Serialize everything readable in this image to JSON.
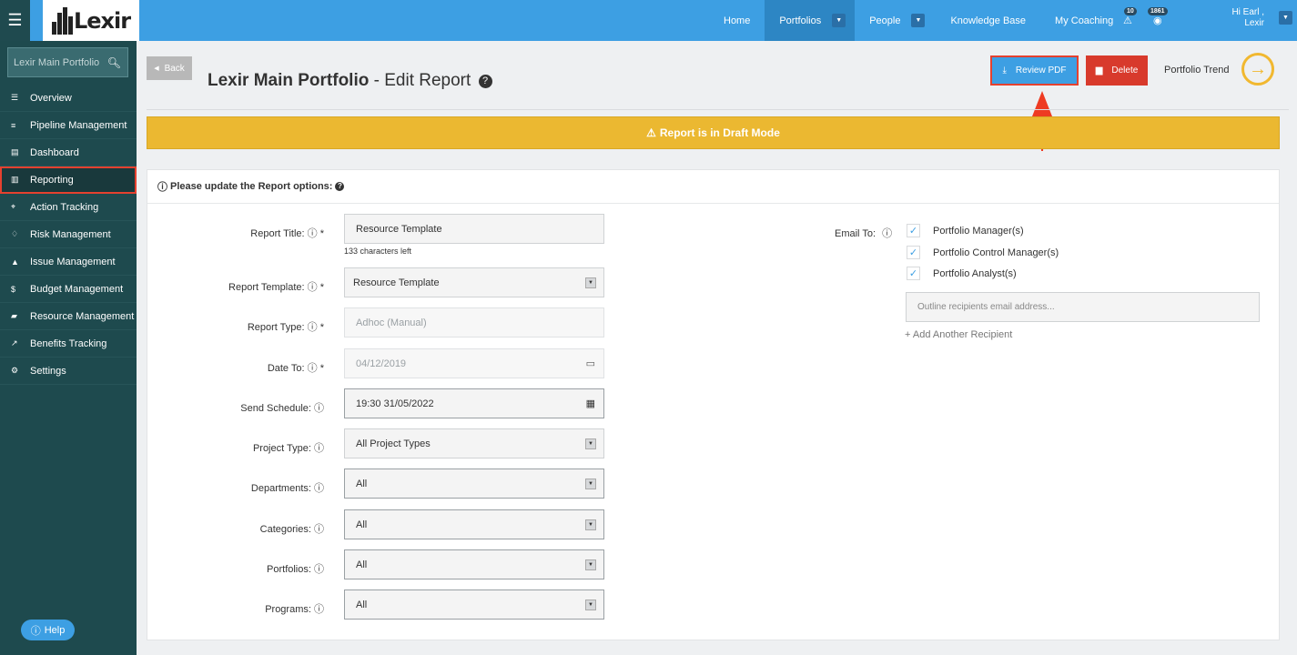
{
  "topbar": {
    "menu_icon": "hamburger-icon",
    "logo_text": "Lexir",
    "nav": [
      {
        "label": "Home"
      },
      {
        "label": "Portfolios"
      },
      {
        "label": "People"
      },
      {
        "label": "Knowledge Base"
      },
      {
        "label": "My Coaching"
      }
    ],
    "alerts_count": "10",
    "notifications_count": "1861",
    "greeting": "Hi Earl ,",
    "user_name": "Lexir"
  },
  "sidebar": {
    "search_placeholder": "Lexir Main Portfolio",
    "items": [
      {
        "label": "Overview",
        "icon": "list-icon"
      },
      {
        "label": "Pipeline Management",
        "icon": "lines-icon"
      },
      {
        "label": "Dashboard",
        "icon": "dashboard-icon"
      },
      {
        "label": "Reporting",
        "icon": "bar-chart-icon"
      },
      {
        "label": "Action Tracking",
        "icon": "crosshair-icon"
      },
      {
        "label": "Risk Management",
        "icon": "lightbulb-icon"
      },
      {
        "label": "Issue Management",
        "icon": "warning-icon"
      },
      {
        "label": "Budget Management",
        "icon": "dollar-icon"
      },
      {
        "label": "Resource Management",
        "icon": "folder-icon"
      },
      {
        "label": "Benefits Tracking",
        "icon": "line-chart-icon"
      },
      {
        "label": "Settings",
        "icon": "gears-icon"
      }
    ],
    "help_label": "Help"
  },
  "header": {
    "back_label": "Back",
    "title_bold": "Lexir Main Portfolio",
    "title_rest": " - Edit Report",
    "review_pdf_label": "Review PDF",
    "delete_label": "Delete",
    "trend_label": "Portfolio Trend"
  },
  "banner": {
    "text": "Report is in Draft Mode"
  },
  "form": {
    "heading": "Please update the Report options:",
    "report_title_label": "Report Title:",
    "report_title_value": "Resource Template",
    "chars_left": "133 characters left",
    "report_template_label": "Report Template:",
    "report_template_value": "Resource Template",
    "report_type_label": "Report Type:",
    "report_type_value": "Adhoc (Manual)",
    "date_to_label": "Date To:",
    "date_to_value": "04/12/2019",
    "send_schedule_label": "Send Schedule:",
    "send_schedule_value": "19:30 31/05/2022",
    "project_type_label": "Project Type:",
    "project_type_value": "All Project Types",
    "departments_label": "Departments:",
    "departments_value": "All",
    "categories_label": "Categories:",
    "categories_value": "All",
    "portfolios_label": "Portfolios:",
    "portfolios_value": "All",
    "programs_label": "Programs:",
    "programs_value": "All",
    "required_mark": "*",
    "email_to_label": "Email To:",
    "recipients": [
      {
        "label": "Portfolio Manager(s)",
        "checked": true
      },
      {
        "label": "Portfolio Control Manager(s)",
        "checked": true
      },
      {
        "label": "Portfolio Analyst(s)",
        "checked": true
      }
    ],
    "email_placeholder": "Outline recipients email address...",
    "add_recipient_label": "Add Another Recipient"
  },
  "colors": {
    "topbar": "#3d9fe3",
    "sidebar": "#1e4a4e",
    "banner": "#ebb831",
    "delete": "#d83a2c",
    "highlight": "#e5412f",
    "trend": "#f1b830"
  }
}
